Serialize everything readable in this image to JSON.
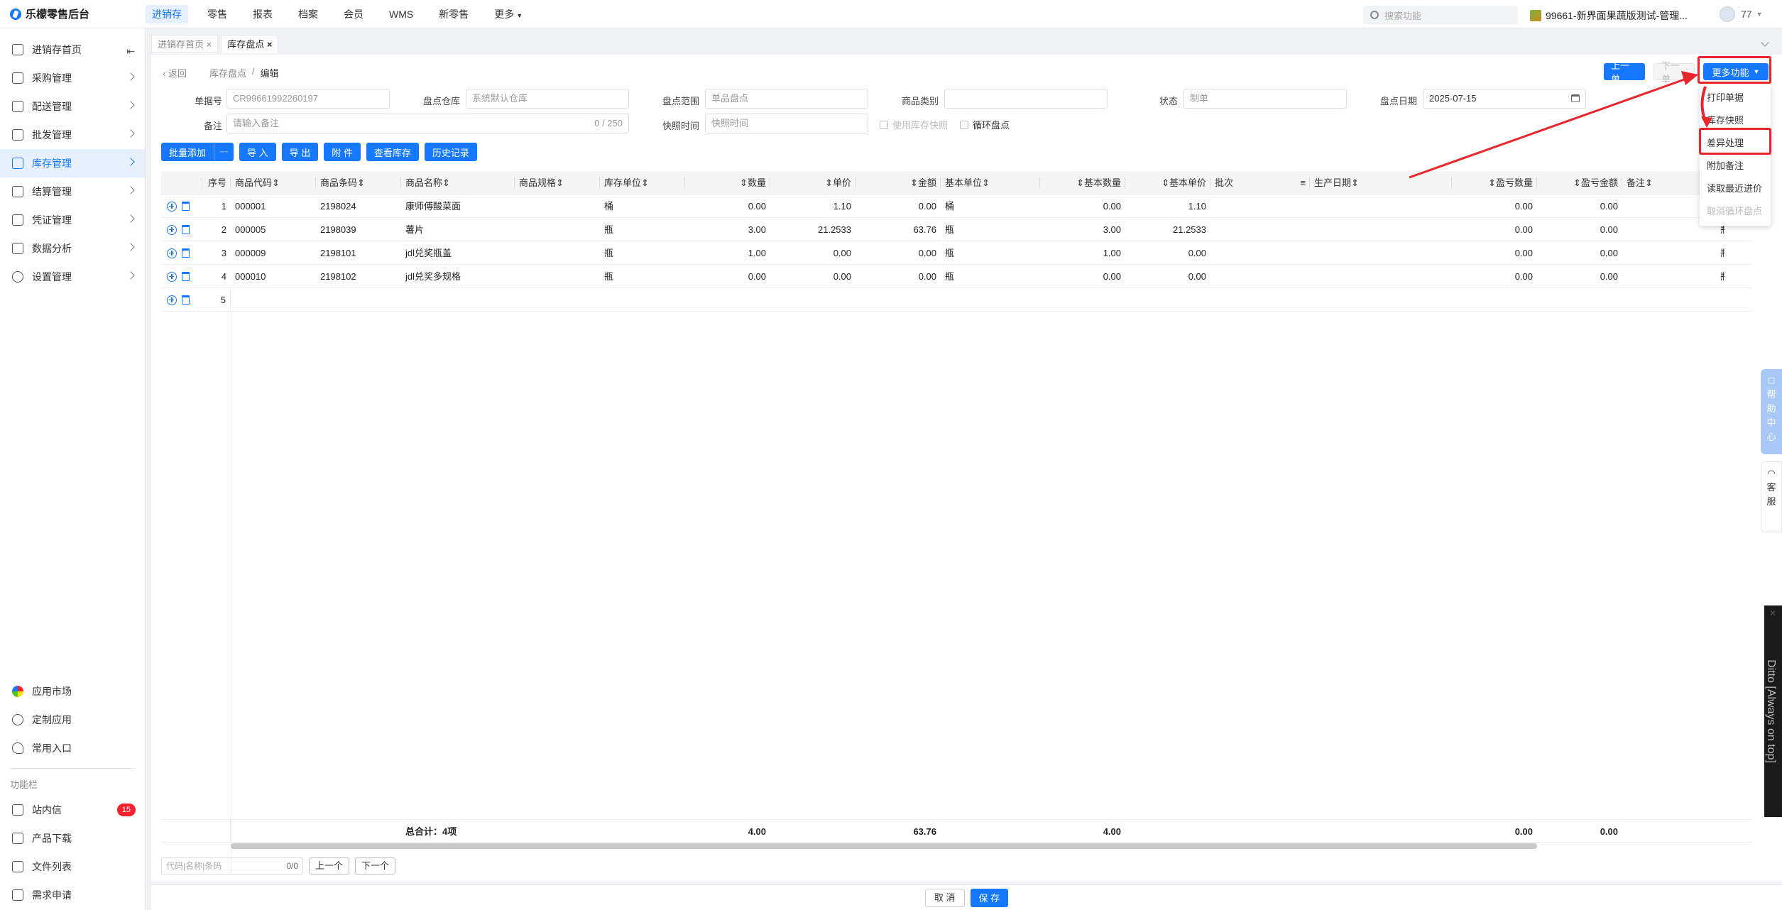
{
  "app": {
    "title": "乐檬零售后台"
  },
  "topnav": [
    "进销存",
    "零售",
    "报表",
    "档案",
    "会员",
    "WMS",
    "新零售",
    "更多"
  ],
  "search": {
    "placeholder": "搜索功能"
  },
  "store": {
    "name": "99661-新界面果蔬版测试-管理..."
  },
  "user": {
    "name": "77"
  },
  "sidebar": {
    "items": [
      {
        "label": "进销存首页"
      },
      {
        "label": "采购管理"
      },
      {
        "label": "配送管理"
      },
      {
        "label": "批发管理"
      },
      {
        "label": "库存管理"
      },
      {
        "label": "结算管理"
      },
      {
        "label": "凭证管理"
      },
      {
        "label": "数据分析"
      },
      {
        "label": "设置管理"
      }
    ],
    "bottom": [
      {
        "label": "应用市场"
      },
      {
        "label": "定制应用"
      },
      {
        "label": "常用入口"
      }
    ],
    "section": "功能栏",
    "tools": [
      {
        "label": "站内信",
        "badge": "15"
      },
      {
        "label": "产品下载"
      },
      {
        "label": "文件列表"
      },
      {
        "label": "需求申请"
      }
    ]
  },
  "tabs": [
    "进销存首页",
    "库存盘点"
  ],
  "breadcrumb": {
    "back": "返回",
    "parent": "库存盘点",
    "current": "编辑"
  },
  "header_buttons": {
    "prev": "上一单",
    "next": "下一单",
    "more": "更多功能"
  },
  "form": {
    "doc_no_label": "单据号",
    "doc_no": "CR99661992260197",
    "warehouse_label": "盘点仓库",
    "warehouse_placeholder": "系统默认仓库",
    "range_label": "盘点范围",
    "range_placeholder": "单品盘点",
    "category_label": "商品类别",
    "category_value": "",
    "status_label": "状态",
    "status_placeholder": "制单",
    "date_label": "盘点日期",
    "date": "2025-07-15",
    "remark_label": "备注",
    "remark_placeholder": "请输入备注",
    "remark_count": "0 / 250",
    "snapshot_label": "快照时间",
    "snapshot_placeholder": "快照时间",
    "use_snapshot": "使用库存快照",
    "cycle_count": "循环盘点"
  },
  "toolbar": {
    "batch_add": "批量添加",
    "more": "⋯",
    "import": "导 入",
    "export": "导 出",
    "attach": "附 件",
    "view_stock": "查看库存",
    "history": "历史记录"
  },
  "columns": [
    "序号",
    "商品代码",
    "商品条码",
    "商品名称",
    "商品规格",
    "库存单位",
    "数量",
    "单价",
    "金额",
    "基本单位",
    "基本数量",
    "基本单价",
    "批次",
    "生产日期",
    "盈亏数量",
    "盈亏金额",
    "备注"
  ],
  "rows": [
    {
      "idx": "1",
      "code": "000001",
      "barcode": "2198024",
      "name": "康师傅酸菜面",
      "spec": "",
      "unit": "桶",
      "qty": "0.00",
      "price": "1.10",
      "amount": "0.00",
      "base_unit": "桶",
      "base_qty": "0.00",
      "base_price": "1.10",
      "pl_qty": "0.00",
      "pl_amt": "0.00",
      "extra": "桶"
    },
    {
      "idx": "2",
      "code": "000005",
      "barcode": "2198039",
      "name": "薯片",
      "spec": "",
      "unit": "瓶",
      "qty": "3.00",
      "price": "21.2533",
      "amount": "63.76",
      "base_unit": "瓶",
      "base_qty": "3.00",
      "base_price": "21.2533",
      "pl_qty": "0.00",
      "pl_amt": "0.00",
      "extra": "瓶"
    },
    {
      "idx": "3",
      "code": "000009",
      "barcode": "2198101",
      "name": "jdl兑奖瓶盖",
      "spec": "",
      "unit": "瓶",
      "qty": "1.00",
      "price": "0.00",
      "amount": "0.00",
      "base_unit": "瓶",
      "base_qty": "1.00",
      "base_price": "0.00",
      "pl_qty": "0.00",
      "pl_amt": "0.00",
      "extra": "瓶"
    },
    {
      "idx": "4",
      "code": "000010",
      "barcode": "2198102",
      "name": "jdl兑奖多规格",
      "spec": "",
      "unit": "瓶",
      "qty": "0.00",
      "price": "0.00",
      "amount": "0.00",
      "base_unit": "瓶",
      "base_qty": "0.00",
      "base_price": "0.00",
      "pl_qty": "0.00",
      "pl_amt": "0.00",
      "extra": "瓶"
    },
    {
      "idx": "5"
    }
  ],
  "total": {
    "label": "总合计：4项",
    "qty": "4.00",
    "amount": "63.76",
    "base_qty": "4.00",
    "pl_qty": "0.00",
    "pl_amt": "0.00"
  },
  "findbar": {
    "placeholder": "代码|名称|条码",
    "count": "0/0",
    "prev": "上一个",
    "next": "下一个"
  },
  "footer": {
    "cancel": "取 消",
    "save": "保 存"
  },
  "dropdown": [
    "打印单据",
    "库存快照",
    "差异处理",
    "附加备注",
    "读取最近进价",
    "取消循环盘点"
  ],
  "float": {
    "help": "帮助中心",
    "service": "客服",
    "ditto": "Ditto [Always on top]"
  },
  "colors": {
    "accent": "#1677ff",
    "annotation": "#e8262b"
  }
}
